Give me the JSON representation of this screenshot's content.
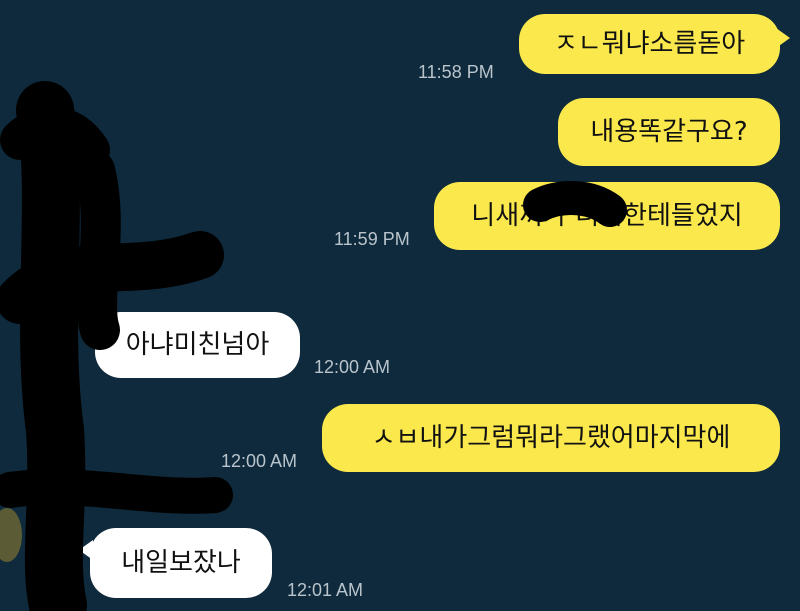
{
  "messages": [
    {
      "direction": "outgoing",
      "text": "ㅈㄴ뭐냐소름돋아",
      "time": "11:58 PM"
    },
    {
      "direction": "outgoing",
      "text": "내용똑같구요?",
      "time": ""
    },
    {
      "direction": "outgoing",
      "text": "니새끼가 너희한테들었지",
      "time": "11:59 PM"
    },
    {
      "direction": "incoming",
      "text": "아냐미친넘아",
      "time": "12:00 AM"
    },
    {
      "direction": "outgoing",
      "text": "ㅅㅂ내가그럼뭐라그랬어마지막에",
      "time": "12:00 AM"
    },
    {
      "direction": "incoming",
      "text": "내일보잤나",
      "time": "12:01 AM"
    }
  ],
  "colors": {
    "background": "#0e2a3c",
    "outgoing_bubble": "#fae84c",
    "incoming_bubble": "#ffffff",
    "timestamp": "#b9c4cc",
    "redaction": "#000000"
  }
}
